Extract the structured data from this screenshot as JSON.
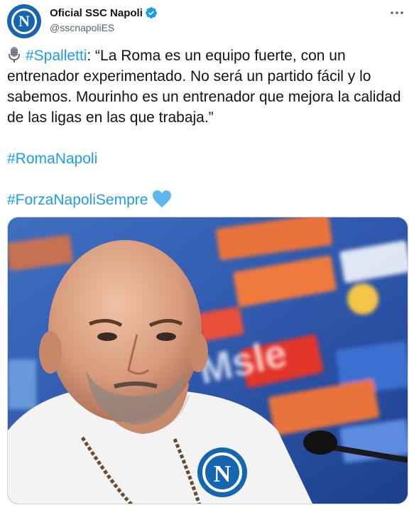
{
  "account": {
    "display_name": "Oficial SSC Napoli",
    "handle": "@sscnapoliES",
    "avatar_letter": "N",
    "verified": true
  },
  "tweet": {
    "hashtag_spalletti": "#Spalletti",
    "quote": ": “La Roma es un equipo fuerte, con un entrenador experimentado. No será un partido fácil y lo sabemos. Mourinho es un entrenador que mejora la calidad de las ligas en las que trabaja.”",
    "hashtag_roma_napoli": "#RomaNapoli",
    "hashtag_forza": "#ForzaNapoliSempre"
  },
  "photo": {
    "shirt_badge_letter": "N",
    "backdrop_sponsor_text": "Msle"
  },
  "colors": {
    "hashtag": "#1d9bf0",
    "napoli_blue": "#1565b0",
    "heart": "#5db7f0",
    "backdrop_blue": "#2a5fb3"
  }
}
